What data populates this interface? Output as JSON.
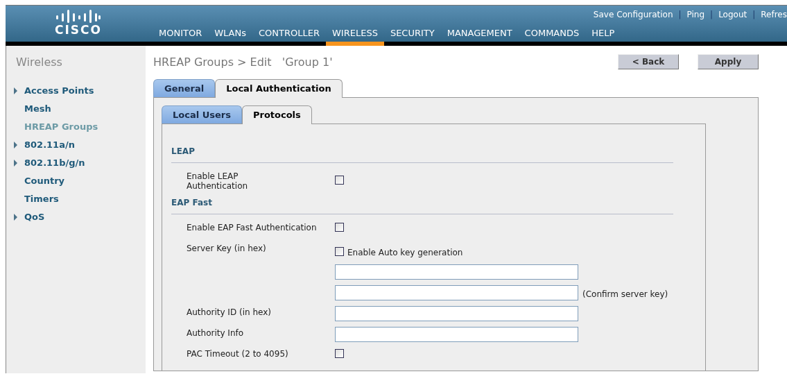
{
  "header": {
    "logo": "CISCO",
    "top_links": [
      {
        "label": "Save Configuration"
      },
      {
        "separator": "|",
        "label": "Ping"
      },
      {
        "separator": "|",
        "label": "Logout"
      },
      {
        "separator": "|",
        "label": "Refres"
      }
    ],
    "nav": [
      {
        "label": "MONITOR",
        "selected": false
      },
      {
        "label": "WLANs",
        "selected": false
      },
      {
        "label": "CONTROLLER",
        "selected": false
      },
      {
        "label": "WIRELESS",
        "selected": true
      },
      {
        "label": "SECURITY",
        "selected": false
      },
      {
        "label": "MANAGEMENT",
        "selected": false
      },
      {
        "label": "COMMANDS",
        "selected": false
      },
      {
        "label": "HELP",
        "selected": false
      }
    ]
  },
  "sidebar": {
    "title": "Wireless",
    "items": [
      {
        "label": "Access Points",
        "expandable": true,
        "selected": false
      },
      {
        "label": "Mesh",
        "expandable": false,
        "selected": false
      },
      {
        "label": "HREAP Groups",
        "expandable": false,
        "selected": true
      },
      {
        "label": "802.11a/n",
        "expandable": true,
        "selected": false
      },
      {
        "label": "802.11b/g/n",
        "expandable": true,
        "selected": false
      },
      {
        "label": "Country",
        "expandable": false,
        "selected": false
      },
      {
        "label": "Timers",
        "expandable": false,
        "selected": false
      },
      {
        "label": "QoS",
        "expandable": true,
        "selected": false
      }
    ]
  },
  "page": {
    "title": "HREAP Groups > Edit   'Group 1'",
    "buttons": [
      "< Back",
      "Apply"
    ]
  },
  "tabs": [
    {
      "label": "General",
      "selected": false
    },
    {
      "label": "Local Authentication",
      "selected": true
    }
  ],
  "subtabs": [
    {
      "label": "Local Users",
      "selected": false
    },
    {
      "label": "Protocols",
      "selected": true
    }
  ],
  "sections": [
    {
      "title": "LEAP",
      "rows": [
        {
          "kind": "checkbox",
          "label": "Enable LEAP Authentication",
          "checked": false
        }
      ]
    },
    {
      "title": "EAP Fast",
      "rows": [
        {
          "kind": "checkbox",
          "label": "Enable EAP Fast Authentication",
          "checked": false
        },
        {
          "kind": "checkbox",
          "label": "Server Key (in hex)",
          "checked": false,
          "option": "Enable Auto key generation"
        },
        {
          "kind": "input"
        },
        {
          "kind": "input",
          "note": "(Confirm server key)"
        },
        {
          "kind": "input",
          "label": "Authority ID (in hex)"
        },
        {
          "kind": "input",
          "label": "Authority Info"
        },
        {
          "kind": "checkbox",
          "label": "PAC Timeout (2 to 4095)",
          "checked": false
        }
      ]
    }
  ]
}
